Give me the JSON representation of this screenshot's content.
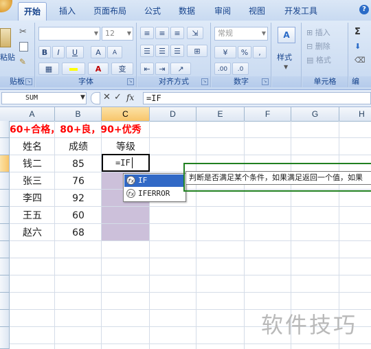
{
  "ribbon": {
    "tabs": [
      "开始",
      "插入",
      "页面布局",
      "公式",
      "数据",
      "审阅",
      "视图",
      "开发工具"
    ],
    "active_tab": "开始",
    "groups": {
      "clipboard": {
        "label": "贴板",
        "paste": "粘贴"
      },
      "font": {
        "label": "字体",
        "size": "12",
        "bold": "B",
        "italic": "I",
        "underline": "U",
        "grow": "A",
        "shrink": "A",
        "phonetic": "变"
      },
      "alignment": {
        "label": "对齐方式"
      },
      "number": {
        "label": "数字",
        "format": "常规",
        "percent": "%",
        "comma": ",",
        "dec_inc": ".00",
        "dec_dec": ".0"
      },
      "styles": {
        "label": "",
        "styles_btn": "样式"
      },
      "cells": {
        "label": "单元格",
        "insert": "插入",
        "delete": "删除",
        "format": "格式"
      },
      "editing": {
        "label": "编",
        "sum": "Σ"
      }
    },
    "colors": {
      "accent": "#15428b",
      "ribbon_bg": "#c6d8f0"
    }
  },
  "formula_bar": {
    "name_box": "SUM",
    "formula": "=IF",
    "cancel": "✕",
    "enter": "✓",
    "fx": "fx"
  },
  "sheet": {
    "columns": [
      "A",
      "B",
      "C",
      "D",
      "E",
      "F",
      "G",
      "H"
    ],
    "selected_column": "C",
    "note": "60+合格，80+良，90+优秀",
    "headers": {
      "name": "姓名",
      "score": "成绩",
      "grade": "等级"
    },
    "rows": [
      {
        "name": "钱二",
        "score": "85"
      },
      {
        "name": "张三",
        "score": "76"
      },
      {
        "name": "李四",
        "score": "92"
      },
      {
        "name": "王五",
        "score": "60"
      },
      {
        "name": "赵六",
        "score": "68"
      }
    ],
    "active_cell_text": "=IF",
    "fill_color": "#ccc0da",
    "note_color": "#ff0000"
  },
  "autocomplete": {
    "items": [
      "IF",
      "IFERROR"
    ],
    "selected": "IF",
    "tooltip": "判断是否满足某个条件，如果满足返回一个值，如果"
  },
  "watermark": "软件技巧"
}
